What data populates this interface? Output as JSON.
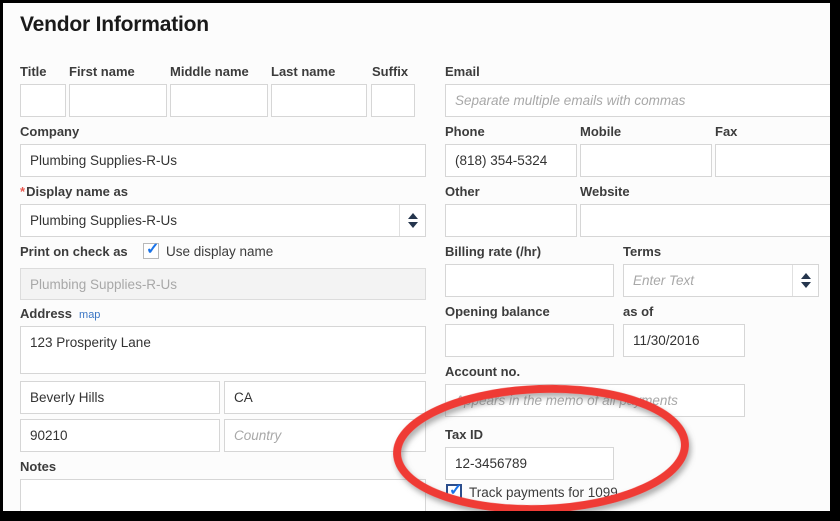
{
  "window": {
    "title": "Vendor Information"
  },
  "colors": {
    "annotation": "#ef3b36",
    "required_star": "#e8584f",
    "link": "#3a75c4",
    "checkbox_tick": "#1a73e8",
    "checkbox_focus_border": "#2b4d8c",
    "frame": "#000000",
    "page_background": "#fcfcfc"
  },
  "left_column": {
    "name_row": {
      "fields": [
        {
          "label": "Title",
          "value": "",
          "placeholder": ""
        },
        {
          "label": "First name",
          "value": "",
          "placeholder": ""
        },
        {
          "label": "Middle name",
          "value": "",
          "placeholder": ""
        },
        {
          "label": "Last name",
          "value": "",
          "placeholder": ""
        },
        {
          "label": "Suffix",
          "value": "",
          "placeholder": ""
        }
      ]
    },
    "company": {
      "label": "Company",
      "value": "Plumbing Supplies-R-Us"
    },
    "display_name": {
      "label": "Display name as",
      "required": true,
      "required_marker": "*",
      "value": "Plumbing Supplies-R-Us"
    },
    "print_on_check": {
      "label": "Print on check as",
      "checkbox_label": "Use display name",
      "checked": true,
      "value": "Plumbing Supplies-R-Us",
      "readonly": true
    },
    "address": {
      "label": "Address",
      "map_link": "map",
      "street": "123 Prosperity Lane",
      "city": "Beverly Hills",
      "state": "CA",
      "zip": "90210",
      "country": "",
      "country_placeholder": "Country"
    },
    "notes": {
      "label": "Notes",
      "value": ""
    }
  },
  "right_column": {
    "email": {
      "label": "Email",
      "value": "",
      "placeholder": "Separate multiple emails with commas"
    },
    "phone": {
      "label": "Phone",
      "value": "(818) 354-5324"
    },
    "mobile": {
      "label": "Mobile",
      "value": ""
    },
    "fax": {
      "label": "Fax",
      "value": ""
    },
    "other": {
      "label": "Other",
      "value": ""
    },
    "website": {
      "label": "Website",
      "value": ""
    },
    "billing_rate": {
      "label": "Billing rate (/hr)",
      "value": ""
    },
    "terms": {
      "label": "Terms",
      "value": "",
      "placeholder": "Enter Text"
    },
    "opening_balance": {
      "label": "Opening balance",
      "value": ""
    },
    "as_of": {
      "label": "as of",
      "value": "11/30/2016"
    },
    "account_no": {
      "label": "Account no.",
      "value": "",
      "placeholder": "Appears in the memo of all payments"
    },
    "tax_id": {
      "label": "Tax ID",
      "value": "12-3456789"
    },
    "track_1099": {
      "label": "Track payments for 1099",
      "checked": true
    }
  }
}
